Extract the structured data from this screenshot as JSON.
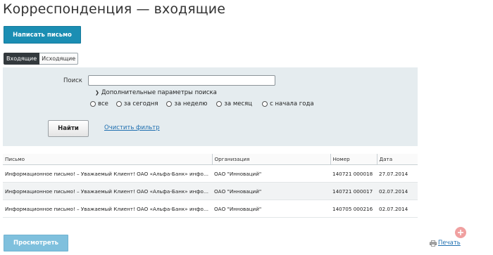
{
  "page": {
    "title": "Корреспонденция — входящие"
  },
  "actions": {
    "compose_label": "Написать письмо"
  },
  "tabs": [
    {
      "label": "Входящие",
      "active": true
    },
    {
      "label": "Исходящие",
      "active": false
    }
  ],
  "filter": {
    "search_label": "Поиск",
    "search_value": "",
    "more_params_label": "Дополнительные параметры поиска",
    "period_options": [
      "все",
      "за сегодня",
      "за неделю",
      "за месяц",
      "с начала года"
    ],
    "find_label": "Найти",
    "clear_label": "Очистить фильтр"
  },
  "table": {
    "columns": [
      "Письмо",
      "Организация",
      "Номер",
      "Дата"
    ],
    "rows": [
      {
        "letter": "Информационное письмо! – Уважаемый Клиент! ОАО «Альфа-Банк» информирует Вас...",
        "org": "ОАО \"Инноваций\"",
        "number": "140721 000018",
        "date": "27.07.2014"
      },
      {
        "letter": "Информационное письмо! – Уважаемый Клиент! ОАО «Альфа-Банк» информирует Вас...",
        "org": "ОАО \"Инноваций\"",
        "number": "140721 000017",
        "date": "02.07.2014"
      },
      {
        "letter": "Информационное письмо! – Уважаемый Клиент! ОАО «Альфа-Банк» информирует Вас...",
        "org": "ОАО \"Инноваций\"",
        "number": "140705 000216",
        "date": "02.07.2014"
      }
    ]
  },
  "footer": {
    "view_label": "Просмотреть",
    "print_label": "Печать"
  },
  "colors": {
    "primary": "#1b8eb3",
    "panel": "#e5ecef",
    "link": "#1f6fb0"
  }
}
